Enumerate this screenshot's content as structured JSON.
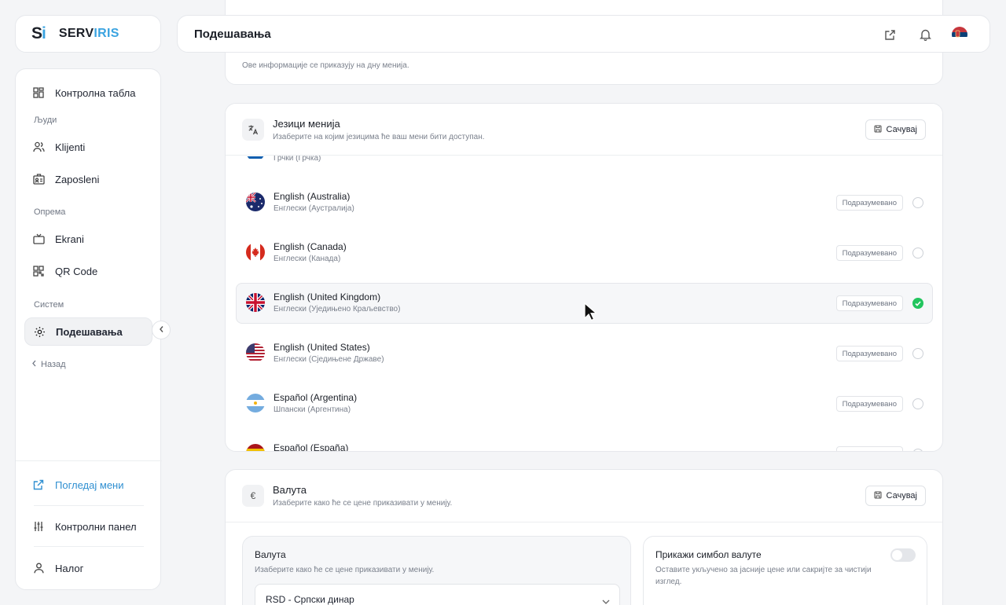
{
  "brand": {
    "mark_a": "S",
    "mark_b": "i",
    "name_a": "SERV",
    "name_b": "IRIS",
    "accent": "#3aa3e0"
  },
  "sidebar": {
    "dashboard": "Контролна табла",
    "section_people": "Људи",
    "clients": "Klijenti",
    "employees": "Zaposleni",
    "section_equipment": "Опрема",
    "screens": "Ekrani",
    "qr": "QR Code",
    "section_system": "Систем",
    "settings": "Подешавања",
    "back": "Назад",
    "view_menu": "Погледај мени",
    "control_panel": "Контролни панел",
    "account": "Налог"
  },
  "header": {
    "title": "Подешавања"
  },
  "top_card": {
    "note": "Ове информације се приказују на дну менија."
  },
  "languages": {
    "title": "Језици менија",
    "subtitle": "Изаберите на којим језицима ће ваш мени бити доступан.",
    "save": "Сачувај",
    "default_label": "Подразумевано",
    "items": [
      {
        "name": "",
        "sub": "Грчки (Грчка)",
        "flag": "greece",
        "selected": false
      },
      {
        "name": "English (Australia)",
        "sub": "Енглески (Аустралија)",
        "flag": "australia",
        "selected": false
      },
      {
        "name": "English (Canada)",
        "sub": "Енглески (Канада)",
        "flag": "canada",
        "selected": false
      },
      {
        "name": "English (United Kingdom)",
        "sub": "Енглески (Уједињено Краљевство)",
        "flag": "uk",
        "selected": true
      },
      {
        "name": "English (United States)",
        "sub": "Енглески (Сједињене Државе)",
        "flag": "usa",
        "selected": false
      },
      {
        "name": "Español (Argentina)",
        "sub": "Шпански (Аргентина)",
        "flag": "argentina",
        "selected": false
      },
      {
        "name": "Español (España)",
        "sub": "",
        "flag": "spain",
        "selected": false
      }
    ]
  },
  "currency": {
    "icon": "€",
    "title": "Валута",
    "subtitle": "Изаберите како ће се цене приказивати у менију.",
    "save": "Сачувај",
    "box_title": "Валута",
    "box_desc": "Изаберите како ће се цене приказивати у менију.",
    "selected": "RSD - Српски динар",
    "symbol_title": "Прикажи симбол валуте",
    "symbol_desc": "Оставите укључено за јасније цене или сакријте за чистији изглед.",
    "symbol_on": false
  },
  "colors": {
    "check_green": "#22c55e",
    "link_blue": "#2f8fd1"
  }
}
